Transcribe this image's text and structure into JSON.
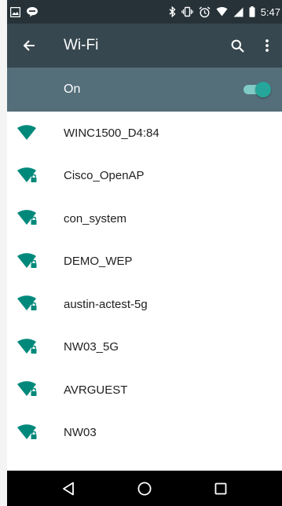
{
  "status_bar": {
    "time": "5:47",
    "left_icons": [
      "image-icon",
      "talk-icon"
    ],
    "right_icons": [
      "bluetooth-icon",
      "vibrate-icon",
      "alarm-icon",
      "wifi-signal-icon",
      "cell-signal-icon",
      "battery-icon"
    ]
  },
  "app_bar": {
    "title": "Wi-Fi",
    "back_icon": "arrow-left-icon",
    "search_icon": "search-icon",
    "menu_icon": "more-vert-icon"
  },
  "wifi_switch": {
    "label": "On",
    "enabled": true
  },
  "networks": [
    {
      "ssid": "WINC1500_D4:84",
      "secured": false
    },
    {
      "ssid": "Cisco_OpenAP",
      "secured": true
    },
    {
      "ssid": "con_system",
      "secured": true
    },
    {
      "ssid": "DEMO_WEP",
      "secured": true
    },
    {
      "ssid": "austin-actest-5g",
      "secured": true
    },
    {
      "ssid": "NW03_5G",
      "secured": true
    },
    {
      "ssid": "AVRGUEST",
      "secured": true
    },
    {
      "ssid": "NW03",
      "secured": true
    }
  ],
  "nav_bar": [
    "back-triangle-icon",
    "home-circle-icon",
    "recents-square-icon"
  ],
  "colors": {
    "status_bar": "#263238",
    "app_bar": "#37474f",
    "switch_bar": "#546e7a",
    "accent": "#26a69a",
    "wifi_icon": "#00897b"
  }
}
